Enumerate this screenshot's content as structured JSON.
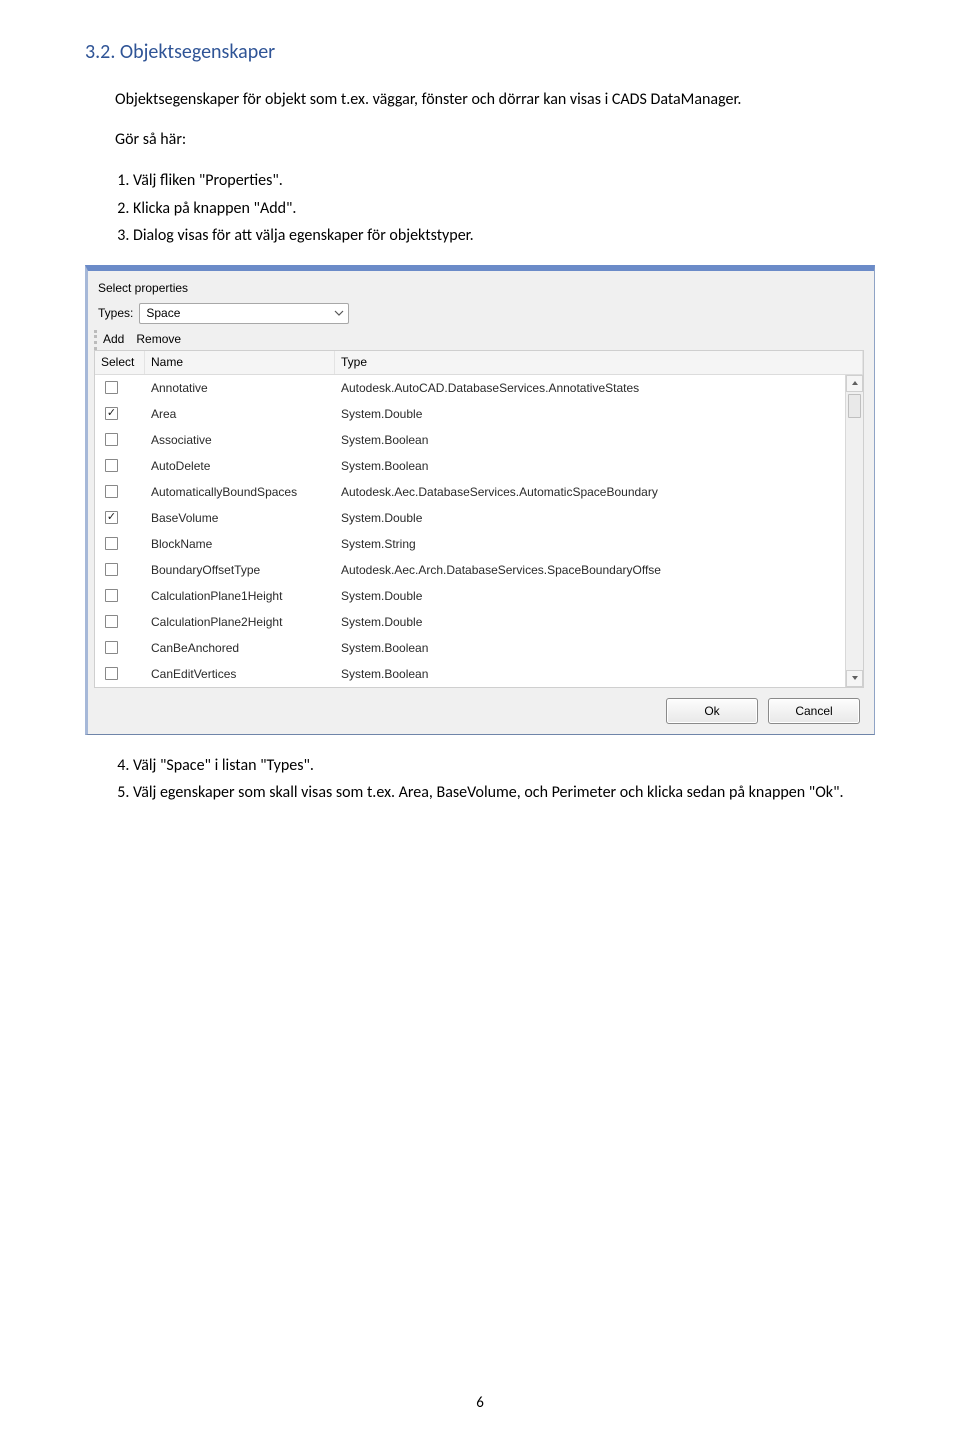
{
  "doc": {
    "section_title": "3.2. Objektsegenskaper",
    "intro1": "Objektsegenskaper för objekt som t.ex. väggar, fönster och dörrar kan visas i CADS DataManager.",
    "intro2": "Gör så här:",
    "steps1": [
      "Välj fliken \"Properties\".",
      "Klicka på knappen \"Add\".",
      "Dialog visas för att välja egenskaper för objektstyper."
    ],
    "steps2": [
      "Välj \"Space\" i listan \"Types\".",
      "Välj egenskaper som skall visas som t.ex. Area, BaseVolume, och Perimeter och klicka sedan på knappen \"Ok\"."
    ],
    "page_number": "6"
  },
  "dialog": {
    "title": "Select properties",
    "types_label": "Types:",
    "types_value": "Space",
    "toolbar": {
      "add": "Add",
      "remove": "Remove"
    },
    "headers": {
      "select": "Select",
      "name": "Name",
      "type": "Type"
    },
    "rows": [
      {
        "checked": false,
        "name": "Annotative",
        "type": "Autodesk.AutoCAD.DatabaseServices.AnnotativeStates"
      },
      {
        "checked": true,
        "name": "Area",
        "type": "System.Double"
      },
      {
        "checked": false,
        "name": "Associative",
        "type": "System.Boolean"
      },
      {
        "checked": false,
        "name": "AutoDelete",
        "type": "System.Boolean"
      },
      {
        "checked": false,
        "name": "AutomaticallyBoundSpaces",
        "type": "Autodesk.Aec.DatabaseServices.AutomaticSpaceBoundary"
      },
      {
        "checked": true,
        "name": "BaseVolume",
        "type": "System.Double"
      },
      {
        "checked": false,
        "name": "BlockName",
        "type": "System.String"
      },
      {
        "checked": false,
        "name": "BoundaryOffsetType",
        "type": "Autodesk.Aec.Arch.DatabaseServices.SpaceBoundaryOffse"
      },
      {
        "checked": false,
        "name": "CalculationPlane1Height",
        "type": "System.Double"
      },
      {
        "checked": false,
        "name": "CalculationPlane2Height",
        "type": "System.Double"
      },
      {
        "checked": false,
        "name": "CanBeAnchored",
        "type": "System.Boolean"
      },
      {
        "checked": false,
        "name": "CanEditVertices",
        "type": "System.Boolean"
      }
    ],
    "buttons": {
      "ok": "Ok",
      "cancel": "Cancel"
    }
  }
}
